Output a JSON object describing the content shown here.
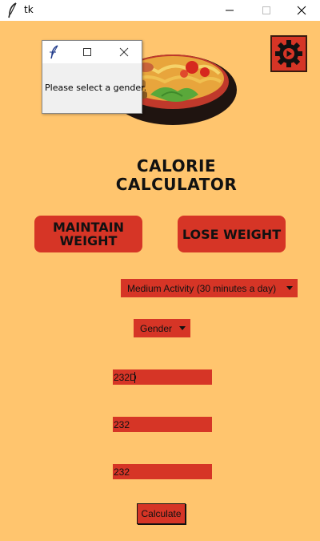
{
  "window": {
    "title": "tk",
    "icon": "feather-icon"
  },
  "colors": {
    "background": "#ffc56e",
    "accent": "#d63526",
    "text": "#111111"
  },
  "header": {
    "settings_icon": "gear-icon",
    "image": "food-bowl"
  },
  "main": {
    "title": "CALORIE\nCALCULATOR",
    "maintain_label": "MAINTAIN\nWEIGHT",
    "lose_label": "LOSE WEIGHT",
    "activity_selected": "Medium Activity (30 minutes a day)",
    "gender_selected": "Gender",
    "fields": [
      "232D",
      "232",
      "232"
    ],
    "calculate_label": "Calculate"
  },
  "popup": {
    "icon": "feather-icon",
    "message": "Please select a gender."
  }
}
